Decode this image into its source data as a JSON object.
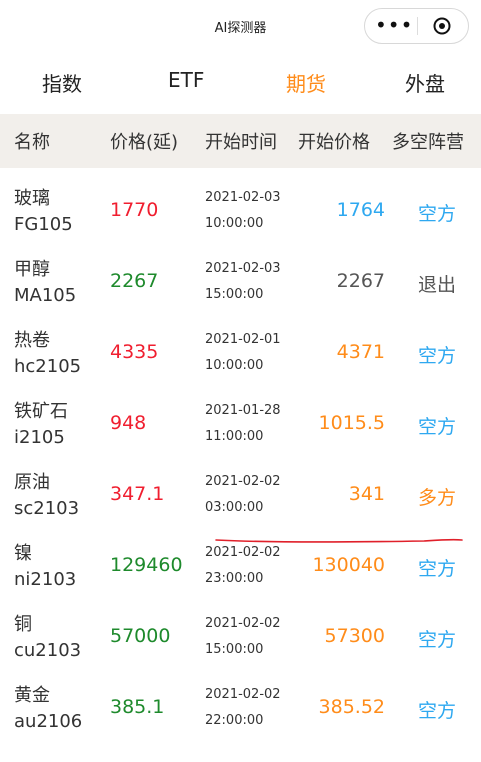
{
  "app": {
    "title": "AI探测器"
  },
  "capsule": {
    "more_icon": "more-dots-icon",
    "close_icon": "target-close-icon"
  },
  "tabs": [
    {
      "label": "指数"
    },
    {
      "label": "ETF"
    },
    {
      "label": "期货",
      "active": true
    },
    {
      "label": "外盘"
    }
  ],
  "table": {
    "headers": [
      "名称",
      "价格(延)",
      "开始时间",
      "开始价格",
      "多空阵营"
    ],
    "rows": [
      {
        "name": "玻璃",
        "code": "FG105",
        "price": "1770",
        "price_color": "red",
        "date": "2021-02-03",
        "time": "10:00:00",
        "start_price": "1764",
        "start_color": "blue",
        "position": "空方",
        "position_color": "blue"
      },
      {
        "name": "甲醇",
        "code": "MA105",
        "price": "2267",
        "price_color": "green",
        "date": "2021-02-03",
        "time": "15:00:00",
        "start_price": "2267",
        "start_color": "gray",
        "position": "退出",
        "position_color": "gray"
      },
      {
        "name": "热卷",
        "code": "hc2105",
        "price": "4335",
        "price_color": "red",
        "date": "2021-02-01",
        "time": "10:00:00",
        "start_price": "4371",
        "start_color": "orange",
        "position": "空方",
        "position_color": "blue"
      },
      {
        "name": "铁矿石",
        "code": "i2105",
        "price": "948",
        "price_color": "red",
        "date": "2021-01-28",
        "time": "11:00:00",
        "start_price": "1015.5",
        "start_color": "orange",
        "position": "空方",
        "position_color": "blue"
      },
      {
        "name": "原油",
        "code": "sc2103",
        "price": "347.1",
        "price_color": "red",
        "date": "2021-02-02",
        "time": "03:00:00",
        "start_price": "341",
        "start_color": "orange",
        "position": "多方",
        "position_color": "orange"
      },
      {
        "name": "镍",
        "code": "ni2103",
        "price": "129460",
        "price_color": "green",
        "date": "2021-02-02",
        "time": "23:00:00",
        "start_price": "130040",
        "start_color": "orange",
        "position": "空方",
        "position_color": "blue"
      },
      {
        "name": "铜",
        "code": "cu2103",
        "price": "57000",
        "price_color": "green",
        "date": "2021-02-02",
        "time": "15:00:00",
        "start_price": "57300",
        "start_color": "orange",
        "position": "空方",
        "position_color": "blue"
      },
      {
        "name": "黄金",
        "code": "au2106",
        "price": "385.1",
        "price_color": "green",
        "date": "2021-02-02",
        "time": "22:00:00",
        "start_price": "385.52",
        "start_color": "orange",
        "position": "空方",
        "position_color": "blue"
      }
    ]
  },
  "colors": {
    "red": "#f01e2f",
    "green": "#1e8a2c",
    "orange": "#ff8c1a",
    "blue": "#2ea8f0",
    "gray": "#555555",
    "annotation": "#e0202a"
  }
}
